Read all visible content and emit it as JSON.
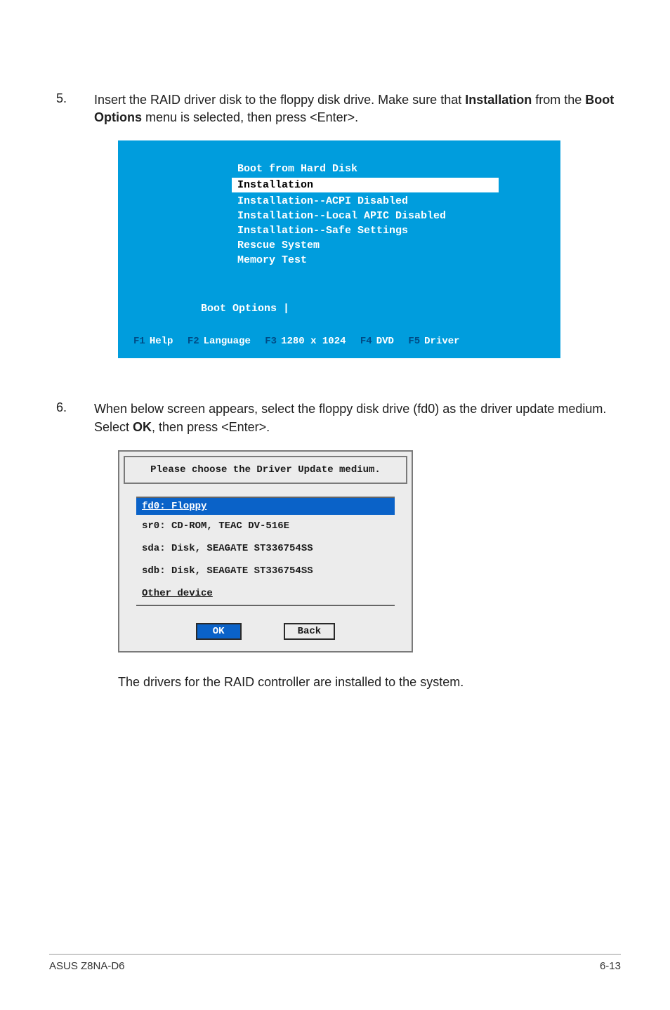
{
  "steps": {
    "s5": {
      "num": "5.",
      "text_a": "Insert the RAID driver disk to the floppy disk drive. Make sure that ",
      "bold_a": "Installation",
      "text_b": " from the ",
      "bold_b": "Boot Options",
      "text_c": " menu is selected, then press <Enter>."
    },
    "s6": {
      "num": "6.",
      "text_a": "When below screen appears, select the floppy disk drive (fd0) as the driver update medium. Select ",
      "bold_a": "OK",
      "text_b": ", then press <Enter>."
    }
  },
  "bootscreen": {
    "items": {
      "i0": "Boot from Hard Disk",
      "i1": "Installation",
      "i2": "Installation--ACPI Disabled",
      "i3": "Installation--Local APIC Disabled",
      "i4": "Installation--Safe Settings",
      "i5": "Rescue System",
      "i6": "Memory Test"
    },
    "options_label": "Boot Options |",
    "footer": {
      "f1k": "F1",
      "f1t": "Help",
      "f2k": "F2",
      "f2t": "Language",
      "f3k": "F3",
      "f3t": "1280 x 1024",
      "f4k": "F4",
      "f4t": "DVD",
      "f5k": "F5",
      "f5t": "Driver"
    }
  },
  "dialog": {
    "title": "Please choose the Driver Update medium.",
    "items": {
      "d0": "fd0: Floppy",
      "d1": "sr0: CD-ROM, TEAC DV-516E",
      "d2": "sda: Disk, SEAGATE ST336754SS",
      "d3": "sdb: Disk, SEAGATE ST336754SS",
      "d4": "Other device"
    },
    "ok": "OK",
    "back": "Back"
  },
  "final": "The drivers for the RAID controller are installed to the system.",
  "footer": {
    "left": "ASUS Z8NA-D6",
    "right": "6-13"
  }
}
